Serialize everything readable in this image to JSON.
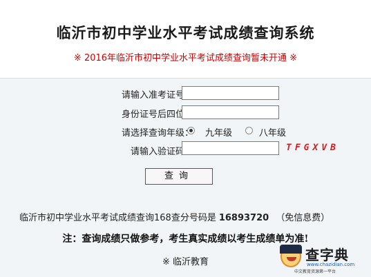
{
  "header": {
    "title": "临沂市初中学业水平考试成绩查询系统",
    "notice": "※ 2016年临沂市初中学业水平考试成绩查询暂未开通 ※"
  },
  "form": {
    "exam_id_label": "请输入准考证号：",
    "exam_id_value": "",
    "id_last4_label": "身份证号后四位：",
    "id_last4_value": "",
    "grade_label": "请选择查询年级：",
    "grade_options": [
      "九年级",
      "八年级"
    ],
    "grade_selected": "九年级",
    "captcha_label": "请输入验证码：",
    "captcha_value": "",
    "captcha_text": "TFGXVB",
    "submit_label": "查询"
  },
  "info": {
    "text": "临沂市初中学业水平考试成绩查询168查分号码是",
    "number": "16893720",
    "free": "（免信息费）"
  },
  "note": "注：查询成绩只做参考，考生真实成绩以考生成绩单为准!",
  "footer": "※ 临沂教育",
  "watermark": {
    "title": "查字典",
    "url": "www.chazidian.com",
    "slogan": "中文教育资源第一平台"
  }
}
